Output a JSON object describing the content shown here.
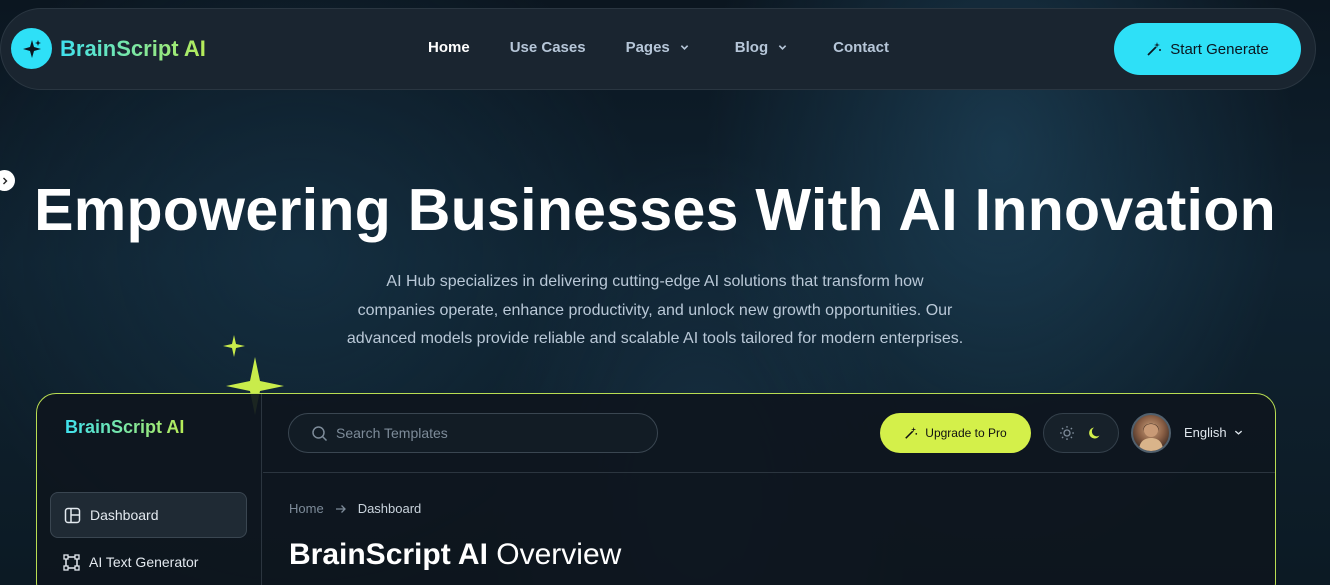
{
  "brand": {
    "name": "BrainScript AI",
    "icon": "sparkle-icon"
  },
  "nav": {
    "items": [
      {
        "label": "Home",
        "active": true,
        "dropdown": false
      },
      {
        "label": "Use Cases",
        "active": false,
        "dropdown": false
      },
      {
        "label": "Pages",
        "active": false,
        "dropdown": true
      },
      {
        "label": "Blog",
        "active": false,
        "dropdown": true
      },
      {
        "label": "Contact",
        "active": false,
        "dropdown": false
      }
    ],
    "cta_label": "Start Generate"
  },
  "hero": {
    "title": "Empowering Businesses With AI Innovation",
    "description_lines": [
      "AI Hub specializes in delivering cutting-edge AI solutions that transform how",
      "companies operate, enhance productivity, and unlock new growth opportunities. Our",
      "advanced models provide reliable and scalable AI tools tailored for modern enterprises."
    ]
  },
  "dashboard": {
    "brand": "BrainScript AI",
    "sidebar": [
      {
        "label": "Dashboard",
        "icon": "layout-icon",
        "active": true
      },
      {
        "label": "AI Text Generator",
        "icon": "text-generator-icon",
        "active": false
      }
    ],
    "search_placeholder": "Search Templates",
    "upgrade_label": "Upgrade to Pro",
    "language": "English",
    "breadcrumb": {
      "home": "Home",
      "current": "Dashboard"
    },
    "heading_bold": "BrainScript AI",
    "heading_light": "Overview"
  },
  "colors": {
    "accent_cyan": "#2ee0f7",
    "accent_lime": "#d4f04a",
    "background": "#0f2230"
  }
}
